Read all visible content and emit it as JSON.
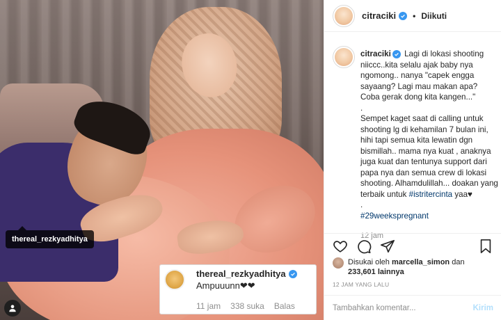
{
  "post": {
    "image_tag_user": "thereal_rezkyadhitya",
    "comment_card": {
      "username": "thereal_rezkyadhitya",
      "text": "Ampuuunn❤❤",
      "time": "11 jam",
      "likes": "338 suka",
      "reply_label": "Balas"
    }
  },
  "header": {
    "username": "citraciki",
    "separator": "•",
    "follow_status": "Diikuti"
  },
  "caption": {
    "username": "citraciki",
    "paragraph1": "Lagi di lokasi shooting niiccc..kita selalu ajak baby nya ngomong.. nanya \"capek engga sayaang? Lagi mau makan apa? Coba gerak dong kita kangen...\"",
    "spacer1": ".",
    "paragraph2": "Sempet kaget saat di calling untuk shooting lg di kehamilan 7 bulan ini, hihi tapi semua kita lewatin dgn bismillah.. mama nya kuat , anaknya juga kuat dan tentunya support dari papa nya dan semua crew di lokasi shooting. Alhamdulillah... doakan yang terbaik untuk",
    "inline_tag": "#istritercinta",
    "paragraph2_end": "yaa♥",
    "spacer2": ".",
    "hashtag": "#29weekspregnant",
    "time": "12 jam"
  },
  "likes": {
    "prefix": "Disukai oleh",
    "user": "marcella_simon",
    "middle": "dan",
    "count": "233,601",
    "suffix": "lainnya"
  },
  "posted_time": "12 JAM YANG LALU",
  "comment_input": {
    "placeholder": "Tambahkan komentar...",
    "send_label": "Kirim"
  },
  "colors": {
    "verified": "#3897f0",
    "send_disabled": "#b2dffc",
    "hashtag": "#00376b"
  },
  "icons": [
    "heart-icon",
    "comment-icon",
    "share-icon",
    "bookmark-icon",
    "verified-icon",
    "user-tag-icon"
  ]
}
